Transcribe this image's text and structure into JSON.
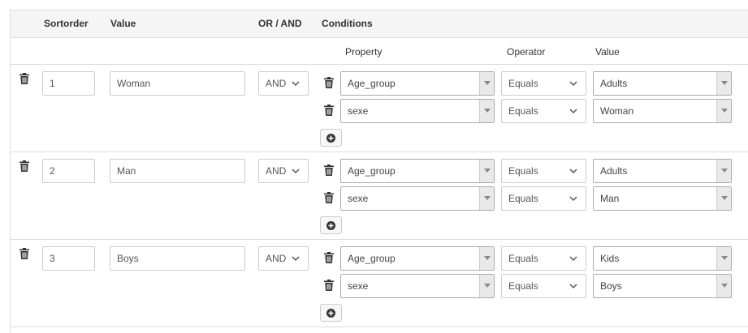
{
  "headers": {
    "sortorder": "Sortorder",
    "value": "Value",
    "or_and": "OR / AND",
    "conditions": "Conditions"
  },
  "subheaders": {
    "property": "Property",
    "operator": "Operator",
    "value": "Value"
  },
  "rows": [
    {
      "sortorder": "1",
      "value": "Woman",
      "logic": "AND",
      "conditions": [
        {
          "property": "Age_group",
          "operator": "Equals",
          "value": "Adults"
        },
        {
          "property": "sexe",
          "operator": "Equals",
          "value": "Woman"
        }
      ]
    },
    {
      "sortorder": "2",
      "value": "Man",
      "logic": "AND",
      "conditions": [
        {
          "property": "Age_group",
          "operator": "Equals",
          "value": "Adults"
        },
        {
          "property": "sexe",
          "operator": "Equals",
          "value": "Man"
        }
      ]
    },
    {
      "sortorder": "3",
      "value": "Boys",
      "logic": "AND",
      "conditions": [
        {
          "property": "Age_group",
          "operator": "Equals",
          "value": "Kids"
        },
        {
          "property": "sexe",
          "operator": "Equals",
          "value": "Boys"
        }
      ]
    }
  ],
  "icons": {
    "delete_row": "trash-icon",
    "delete_condition": "trash-icon",
    "add_condition": "plus-circle-icon",
    "dropdown": "chevron-down-icon",
    "select_arrow": "caret-down-icon"
  },
  "colors": {
    "header_bg": "#f5f5f5",
    "border": "#dddddd",
    "icon": "#333333"
  }
}
